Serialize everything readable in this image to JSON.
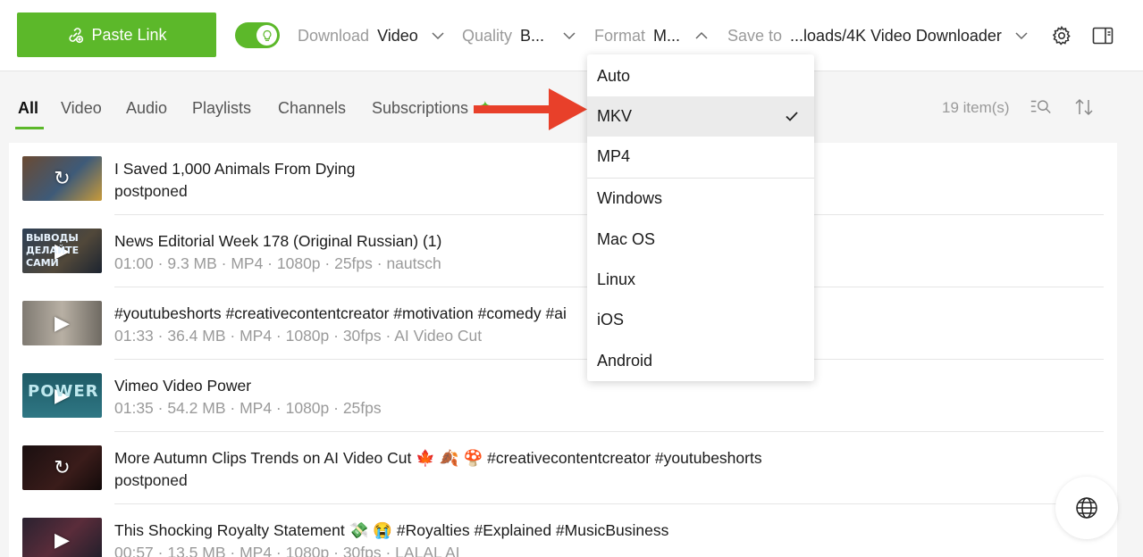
{
  "toolbar": {
    "paste_label": "Paste Link",
    "smart_mode_on": true,
    "download_label": "Download",
    "download_value": "Video",
    "quality_label": "Quality",
    "quality_value": "B...",
    "format_label": "Format",
    "format_value": "M...",
    "save_label": "Save to",
    "save_value": "...loads/4K Video Downloader",
    "icons": [
      "settings-gear-icon",
      "sidebar-panel-icon"
    ]
  },
  "tabs": {
    "items": [
      {
        "label": "All",
        "active": true
      },
      {
        "label": "Video",
        "active": false
      },
      {
        "label": "Audio",
        "active": false
      },
      {
        "label": "Playlists",
        "active": false
      },
      {
        "label": "Channels",
        "active": false
      },
      {
        "label": "Subscriptions",
        "active": false
      }
    ],
    "item_count": "19 item(s)"
  },
  "list": {
    "rows": [
      {
        "title": "I Saved 1,000 Animals From Dying",
        "meta": "postponed",
        "state": "retry",
        "thumb_text": ""
      },
      {
        "title": "News Editorial Week 178 (Original Russian) (1)",
        "meta": "01:00 · 9.3 MB · MP4 · 1080p · 25fps · nautsch",
        "state": "play",
        "thumb_text": "ВЫВОДЫ ДЕЛАЙТЕ САМИ"
      },
      {
        "title": "#youtubeshorts #creativecontentcreator #motivation #comedy #ai",
        "meta": "01:33 · 36.4 MB · MP4 · 1080p · 30fps · AI Video Cut",
        "state": "play",
        "thumb_text": ""
      },
      {
        "title": "Vimeo   Video Power",
        "meta": "01:35 · 54.2 MB · MP4 · 1080p · 25fps",
        "state": "play",
        "thumb_text": "POWER"
      },
      {
        "title": "More Autumn Clips Trends on AI Video Cut 🍁 🍂 🍄 #creativecontentcreator #youtubeshorts",
        "meta": "postponed",
        "state": "retry",
        "thumb_text": ""
      },
      {
        "title": "This Shocking Royalty Statement 💸 😭 #Royalties #Explained #MusicBusiness",
        "meta": "00:57 · 13.5 MB · MP4 · 1080p · 30fps · LALAL AI",
        "state": "play",
        "thumb_text": ""
      }
    ]
  },
  "format_dropdown": {
    "items": [
      "Auto",
      "MKV",
      "MP4",
      "Windows",
      "Mac OS",
      "Linux",
      "iOS",
      "Android"
    ],
    "selected": "MKV"
  },
  "colors": {
    "accent": "#5cb82a",
    "annotation_arrow": "#e8402a"
  }
}
